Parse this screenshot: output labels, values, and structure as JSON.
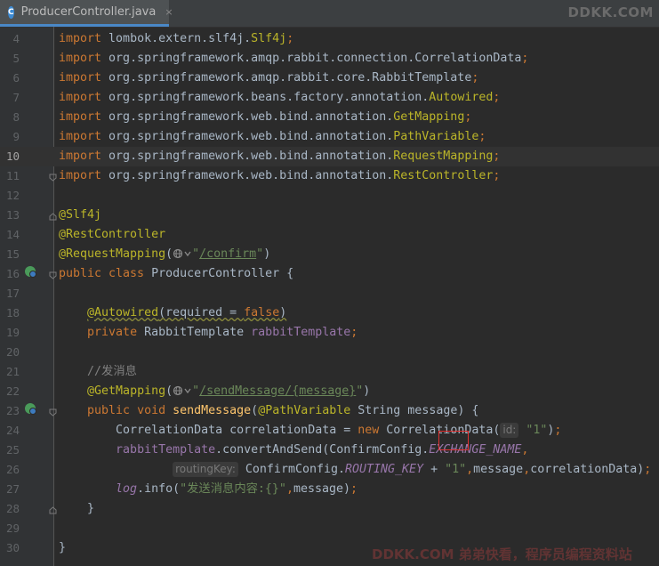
{
  "tab": {
    "filename": "ProducerController.java",
    "icon_letter": "C",
    "close": "×"
  },
  "watermark": {
    "top": "DDKK.COM",
    "bottom": "DDKK.COM 弟弟快看，程序员编程资料站"
  },
  "lines": [
    {
      "n": "4",
      "t": [
        [
          "kw",
          "import "
        ],
        [
          "p",
          "lombok.extern.slf4j."
        ],
        [
          "ann",
          "Slf4j"
        ],
        [
          "kw",
          ";"
        ]
      ]
    },
    {
      "n": "5",
      "t": [
        [
          "kw",
          "import "
        ],
        [
          "p",
          "org.springframework.amqp.rabbit.connection.CorrelationData"
        ],
        [
          "kw",
          ";"
        ]
      ]
    },
    {
      "n": "6",
      "t": [
        [
          "kw",
          "import "
        ],
        [
          "p",
          "org.springframework.amqp.rabbit.core.RabbitTemplate"
        ],
        [
          "kw",
          ";"
        ]
      ]
    },
    {
      "n": "7",
      "t": [
        [
          "kw",
          "import "
        ],
        [
          "p",
          "org.springframework.beans.factory.annotation."
        ],
        [
          "ann",
          "Autowired"
        ],
        [
          "kw",
          ";"
        ]
      ]
    },
    {
      "n": "8",
      "t": [
        [
          "kw",
          "import "
        ],
        [
          "p",
          "org.springframework.web.bind.annotation."
        ],
        [
          "ann",
          "GetMapping"
        ],
        [
          "kw",
          ";"
        ]
      ]
    },
    {
      "n": "9",
      "t": [
        [
          "kw",
          "import "
        ],
        [
          "p",
          "org.springframework.web.bind.annotation."
        ],
        [
          "ann",
          "PathVariable"
        ],
        [
          "kw",
          ";"
        ]
      ]
    },
    {
      "n": "10",
      "t": [
        [
          "kw",
          "import "
        ],
        [
          "p",
          "org.springframework.web.bind.annotation."
        ],
        [
          "ann",
          "RequestMapping"
        ],
        [
          "kw",
          ";"
        ]
      ]
    },
    {
      "n": "11",
      "t": [
        [
          "kw",
          "import "
        ],
        [
          "p",
          "org.springframework.web.bind.annotation."
        ],
        [
          "ann",
          "RestController"
        ],
        [
          "kw",
          ";"
        ]
      ]
    },
    {
      "n": "12",
      "t": []
    },
    {
      "n": "13",
      "t": [
        [
          "ann",
          "@Slf4j"
        ]
      ]
    },
    {
      "n": "14",
      "t": [
        [
          "ann",
          "@RestController"
        ]
      ]
    },
    {
      "n": "15",
      "t": [
        [
          "ann",
          "@RequestMapping"
        ],
        [
          "p",
          "("
        ],
        [
          "globe",
          ""
        ],
        [
          "str",
          "\""
        ],
        [
          "strl",
          "/confirm"
        ],
        [
          "str",
          "\""
        ],
        [
          "p",
          ")"
        ]
      ]
    },
    {
      "n": "16",
      "t": [
        [
          "kw",
          "public class "
        ],
        [
          "p",
          "ProducerController {"
        ]
      ]
    },
    {
      "n": "17",
      "t": []
    },
    {
      "n": "18",
      "t": [
        [
          "p",
          "    "
        ],
        [
          "annw",
          "@Autowired"
        ],
        [
          "pw",
          "(required = "
        ],
        [
          "kww",
          "false"
        ],
        [
          "pw",
          ")"
        ]
      ]
    },
    {
      "n": "19",
      "t": [
        [
          "p",
          "    "
        ],
        [
          "kw",
          "private "
        ],
        [
          "p",
          "RabbitTemplate "
        ],
        [
          "fld",
          "rabbitTemplate"
        ],
        [
          "kw",
          ";"
        ]
      ]
    },
    {
      "n": "20",
      "t": []
    },
    {
      "n": "21",
      "t": [
        [
          "p",
          "    "
        ],
        [
          "cm",
          "//发消息"
        ]
      ]
    },
    {
      "n": "22",
      "t": [
        [
          "p",
          "    "
        ],
        [
          "ann",
          "@GetMapping"
        ],
        [
          "p",
          "("
        ],
        [
          "globe",
          ""
        ],
        [
          "str",
          "\""
        ],
        [
          "strl",
          "/sendMessage/{message}"
        ],
        [
          "str",
          "\""
        ],
        [
          "p",
          ")"
        ]
      ]
    },
    {
      "n": "23",
      "t": [
        [
          "p",
          "    "
        ],
        [
          "kw",
          "public void "
        ],
        [
          "fn",
          "sendMessage"
        ],
        [
          "p",
          "("
        ],
        [
          "ann",
          "@PathVariable "
        ],
        [
          "p",
          "String message) {"
        ]
      ]
    },
    {
      "n": "24",
      "t": [
        [
          "p",
          "        CorrelationData correlationData = "
        ],
        [
          "kw",
          "new "
        ],
        [
          "p",
          "CorrelationData("
        ],
        [
          "hint",
          "id:"
        ],
        [
          "str",
          " \"1\""
        ],
        [
          "p",
          ")"
        ],
        [
          "kw",
          ";"
        ]
      ]
    },
    {
      "n": "25",
      "t": [
        [
          "p",
          "        "
        ],
        [
          "fld",
          "rabbitTemplate"
        ],
        [
          "p",
          ".convertAndSend(ConfirmConfig."
        ],
        [
          "sfld",
          "EXCHANGE_NAME"
        ],
        [
          "kw",
          ","
        ]
      ]
    },
    {
      "n": "26",
      "t": [
        [
          "p",
          "                "
        ],
        [
          "hint",
          "routingKey:"
        ],
        [
          "p",
          " ConfirmConfig."
        ],
        [
          "sfld",
          "ROUTING_KEY"
        ],
        [
          "p",
          " + "
        ],
        [
          "str",
          "\"1\""
        ],
        [
          "kw",
          ","
        ],
        [
          "p",
          "message"
        ],
        [
          "kw",
          ","
        ],
        [
          "p",
          "correlationData)"
        ],
        [
          "kw",
          ";"
        ]
      ]
    },
    {
      "n": "27",
      "t": [
        [
          "p",
          "        "
        ],
        [
          "sfld",
          "log"
        ],
        [
          "p",
          ".info("
        ],
        [
          "str",
          "\"发送消息内容:{}\""
        ],
        [
          "kw",
          ","
        ],
        [
          "p",
          "message)"
        ],
        [
          "kw",
          ";"
        ]
      ]
    },
    {
      "n": "28",
      "t": [
        [
          "p",
          "    }"
        ]
      ]
    },
    {
      "n": "29",
      "t": []
    },
    {
      "n": "30",
      "t": [
        [
          "p",
          "}"
        ]
      ]
    }
  ],
  "current_line": "10",
  "colors": {
    "background": "#2b2b2b",
    "keyword": "#cc7832",
    "annotation": "#bbb529",
    "string": "#6a8759",
    "field": "#9876aa"
  }
}
